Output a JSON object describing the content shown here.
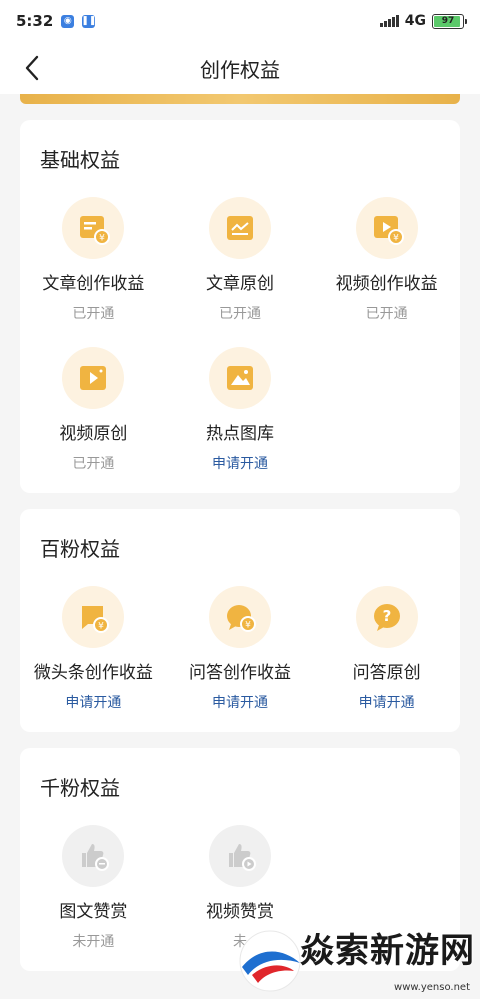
{
  "status_bar": {
    "time": "5:32",
    "network": "4G",
    "battery": "97"
  },
  "nav": {
    "title": "创作权益"
  },
  "colors": {
    "accent_gold": "#f0b441",
    "apply_blue": "#2a5aa0",
    "muted_gray": "#999999"
  },
  "sections": [
    {
      "title": "基础权益",
      "items": [
        {
          "label": "文章创作收益",
          "status": "已开通",
          "icon": "article-income-icon"
        },
        {
          "label": "文章原创",
          "status": "已开通",
          "icon": "article-original-icon"
        },
        {
          "label": "视频创作收益",
          "status": "已开通",
          "icon": "video-income-icon"
        },
        {
          "label": "视频原创",
          "status": "已开通",
          "icon": "video-original-icon"
        },
        {
          "label": "热点图库",
          "status": "申请开通",
          "icon": "image-gallery-icon"
        }
      ]
    },
    {
      "title": "百粉权益",
      "items": [
        {
          "label": "微头条创作收益",
          "status": "申请开通",
          "icon": "micro-headline-income-icon"
        },
        {
          "label": "问答创作收益",
          "status": "申请开通",
          "icon": "qa-income-icon"
        },
        {
          "label": "问答原创",
          "status": "申请开通",
          "icon": "qa-original-icon"
        }
      ]
    },
    {
      "title": "千粉权益",
      "items": [
        {
          "label": "图文赞赏",
          "status": "未开通",
          "icon": "article-reward-icon"
        },
        {
          "label": "视频赞赏",
          "status": "未",
          "icon": "video-reward-icon"
        }
      ]
    }
  ],
  "watermark": {
    "text": "焱索新游网",
    "url": "www.yenso.net"
  }
}
